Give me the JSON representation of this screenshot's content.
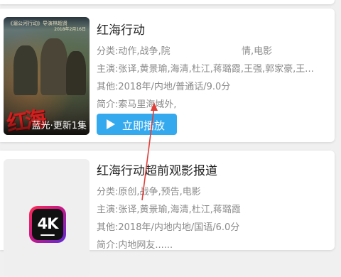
{
  "items": [
    {
      "poster_header": "《湄公河行动》导演林超贤",
      "poster_header_sub": "2018年2月16日",
      "poster_title_art": "红海",
      "poster_caption": "蓝光·更新1集",
      "title": "红海行动",
      "category": "分类:动作,战争,院",
      "category_tail": "情,电影",
      "cast": "主演:张译,黄景瑜,海清,杜江,蒋璐霞,王强,郭家豪,王...",
      "other": "其他:2018年/内地/普通话/9.0分",
      "summary": "简介:索马里海域外,",
      "play_label": "立即播放"
    },
    {
      "icon_text": "4K",
      "title": "红海行动超前观影报道",
      "category": "分类:原创,战争,预告,电影",
      "cast": "主演:张译,黄景瑜,海清,杜江,蒋璐霞",
      "other": "其他:2018年/内地内地/国语/6.0分",
      "summary": "简介:内地网友......"
    }
  ],
  "colors": {
    "play_button": "#35a9ee",
    "annotation_arrow": "#e0403a",
    "title_text": "#222222",
    "meta_text": "#8a8a8a"
  },
  "icons": {
    "play": "play-icon",
    "app": "4k-app-icon"
  }
}
